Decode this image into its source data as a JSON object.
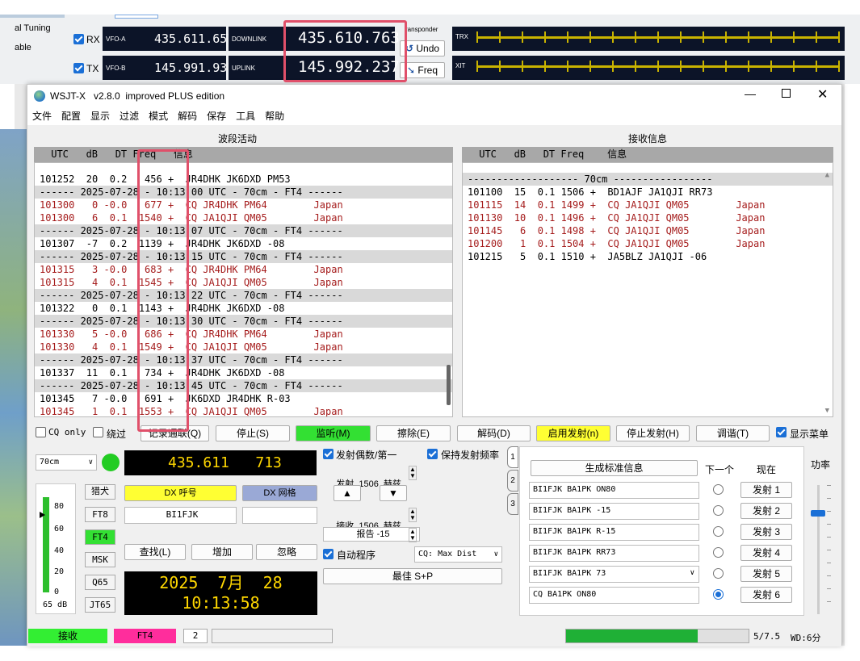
{
  "top": {
    "tuning_label": "al Tuning",
    "able_label": "able",
    "rx_label": "RX",
    "tx_label": "TX",
    "vfoa_label": "VFO-A",
    "vfoa_value": "435.611.657",
    "vfob_label": "VFO-B",
    "vfob_value": "145.991.937",
    "downlink_label": "DOWNLINK",
    "downlink_value": "435.610.763",
    "uplink_label": "UPLINK",
    "uplink_value": "145.992.237",
    "transponder_label": "ransponder",
    "undo_label": "Undo",
    "freq_label": "Freq",
    "trx_label": "TRX",
    "xit_label": "XIT"
  },
  "window": {
    "title": "WSJT-X   v2.8.0  improved PLUS edition",
    "menu": [
      "文件",
      "配置",
      "显示",
      "过滤",
      "模式",
      "解码",
      "保存",
      "工具",
      "帮助"
    ]
  },
  "band": {
    "title": "波段活动",
    "header": " UTC   dB   DT Freq   信息",
    "rows": [
      {
        "t": "norm",
        "text": "101252  20  0.2   456 +  JR4DHK JK6DXD PM53"
      },
      {
        "t": "sep",
        "text": "------ 2025-07-28 - 10:13:00 UTC - 70cm - FT4 ------"
      },
      {
        "t": "cq",
        "text": "101300   0 -0.0   677 +  CQ JR4DHK PM64        Japan"
      },
      {
        "t": "cq",
        "text": "101300   6  0.1  1540 +  CQ JA1QJI QM05        Japan"
      },
      {
        "t": "sep",
        "text": "------ 2025-07-28 - 10:13:07 UTC - 70cm - FT4 ------"
      },
      {
        "t": "norm",
        "text": "101307  -7  0.2  1139 +  JR4DHK JK6DXD -08"
      },
      {
        "t": "sep",
        "text": "------ 2025-07-28 - 10:13:15 UTC - 70cm - FT4 ------"
      },
      {
        "t": "cq",
        "text": "101315   3 -0.0   683 +  CQ JR4DHK PM64        Japan"
      },
      {
        "t": "cq",
        "text": "101315   4  0.1  1545 +  CQ JA1QJI QM05        Japan"
      },
      {
        "t": "sep",
        "text": "------ 2025-07-28 - 10:13:22 UTC - 70cm - FT4 ------"
      },
      {
        "t": "norm",
        "text": "101322   0  0.1  1143 +  JR4DHK JK6DXD -08"
      },
      {
        "t": "sep",
        "text": "------ 2025-07-28 - 10:13:30 UTC - 70cm - FT4 ------"
      },
      {
        "t": "cq",
        "text": "101330   5 -0.0   686 +  CQ JR4DHK PM64        Japan"
      },
      {
        "t": "cq",
        "text": "101330   4  0.1  1549 +  CQ JA1QJI QM05        Japan"
      },
      {
        "t": "sep",
        "text": "------ 2025-07-28 - 10:13:37 UTC - 70cm - FT4 ------"
      },
      {
        "t": "norm",
        "text": "101337  11  0.1   734 +  JR4DHK JK6DXD -08"
      },
      {
        "t": "sep",
        "text": "------ 2025-07-28 - 10:13:45 UTC - 70cm - FT4 ------"
      },
      {
        "t": "norm",
        "text": "101345   7 -0.0   691 +  JK6DXD JR4DHK R-03"
      },
      {
        "t": "cq",
        "text": "101345   1  0.1  1553 +  CQ JA1QJI QM05        Japan"
      }
    ]
  },
  "rx": {
    "title": "接收信息",
    "header": " UTC   dB   DT Freq    信息",
    "rows": [
      {
        "t": "sep",
        "text": "------------------- 70cm -----------------"
      },
      {
        "t": "norm",
        "text": "101100  15  0.1 1506 +  BD1AJF JA1QJI RR73"
      },
      {
        "t": "cq",
        "text": "101115  14  0.1 1499 +  CQ JA1QJI QM05        Japan"
      },
      {
        "t": "cq",
        "text": "101130  10  0.1 1496 +  CQ JA1QJI QM05        Japan"
      },
      {
        "t": "cq",
        "text": "101145   6  0.1 1498 +  CQ JA1QJI QM05        Japan"
      },
      {
        "t": "cq",
        "text": "101200   1  0.1 1504 +  CQ JA1QJI QM05        Japan"
      },
      {
        "t": "norm",
        "text": "101215   5  0.1 1510 +  JA5BLZ JA1QJI -06"
      }
    ]
  },
  "controls": {
    "cq_only": "CQ only",
    "skip": "绕过",
    "log_qso": "记录通联(Q)",
    "stop": "停止(S)",
    "monitor": "监听(M)",
    "erase": "擦除(E)",
    "decode": "解码(D)",
    "enable_tx": "启用发射(n)",
    "halt_tx": "停止发射(H)",
    "tune": "调谐(T)",
    "show_menu": "显示菜单"
  },
  "left": {
    "band": "70cm",
    "freq_int": "435.611",
    "freq_frac": "713",
    "meter_ticks": [
      "80",
      "60",
      "40",
      "20",
      "0"
    ],
    "meter_db": "65 dB",
    "modes": [
      "猎犬",
      "FT8",
      "FT4",
      "MSK",
      "Q65",
      "JT65"
    ],
    "dx_call_btn": "DX 呼号",
    "dx_grid_btn": "DX 网格",
    "dx_call": "BI1FJK",
    "dx_grid": "",
    "lookup": "查找(L)",
    "add": "增加",
    "ignore": "忽略",
    "date": "2025  7月  28",
    "time": "10:13:58"
  },
  "mid": {
    "tx_even": "发射偶数/第一",
    "hold_tx": "保持发射频率",
    "tx_label": "发射  1506  赫兹",
    "up": "▲",
    "down": "▼",
    "rx_label": "接收  1506  赫兹",
    "report": "报告 -15",
    "auto_seq": "自动程序",
    "cq_sel": "CQ: Max Dist",
    "best": "最佳 S+P"
  },
  "right": {
    "gen_std": "生成标准信息",
    "next": "下一个",
    "now": "现在",
    "power": "功率",
    "tabs": [
      "1",
      "2",
      "3"
    ],
    "msgs": [
      "BI1FJK BA1PK ON80",
      "BI1FJK BA1PK -15",
      "BI1FJK BA1PK R-15",
      "BI1FJK BA1PK RR73",
      "BI1FJK BA1PK 73",
      "CQ BA1PK ON80"
    ],
    "tx_btns": [
      "发射 1",
      "发射 2",
      "发射 3",
      "发射 4",
      "发射 5",
      "发射 6"
    ]
  },
  "status": {
    "rx": "接收",
    "mode": "FT4",
    "num": "2",
    "progress_text": "5/7.5",
    "progress": 0.5,
    "wd": "WD:6分"
  }
}
